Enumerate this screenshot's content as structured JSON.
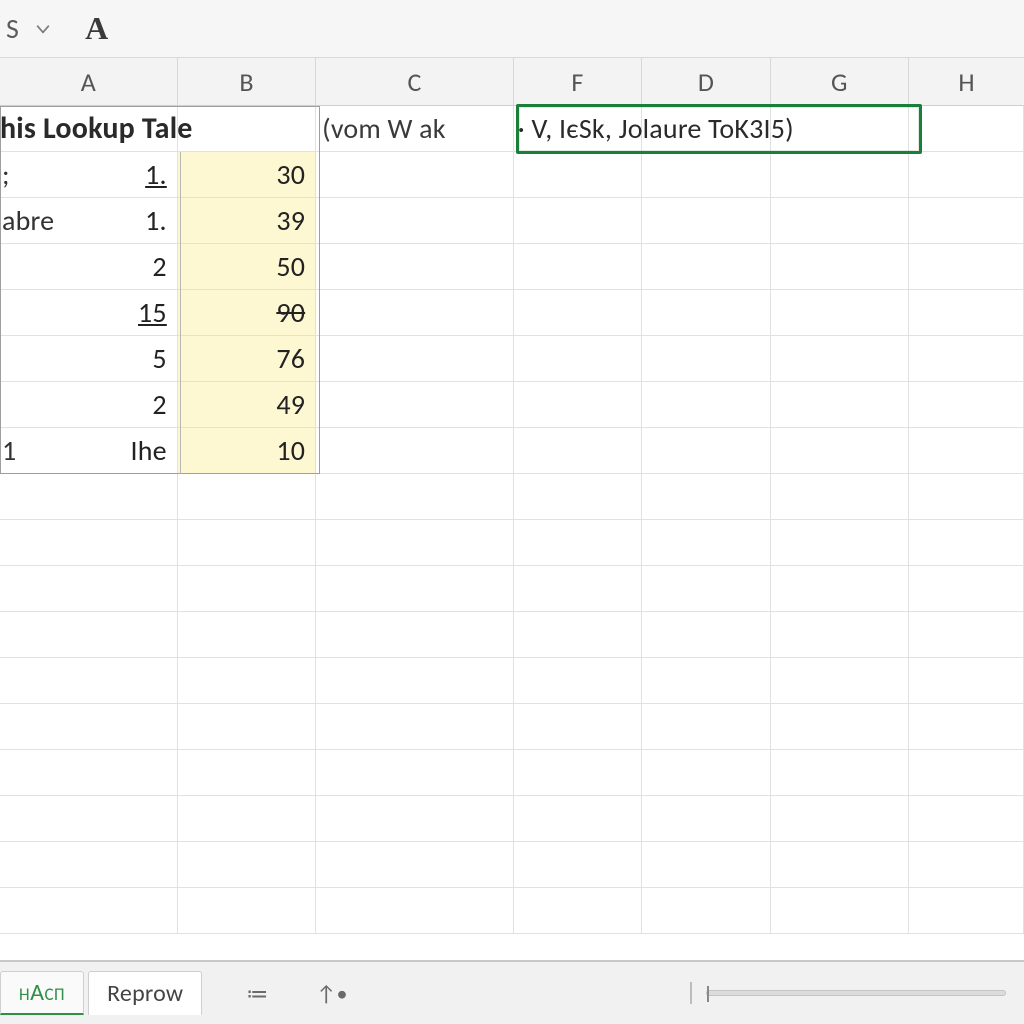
{
  "topbar": {
    "namebox_fragment": "S",
    "font_glyph": "A"
  },
  "columns": [
    "A",
    "B",
    "C",
    "F",
    "D",
    "G",
    "H"
  ],
  "title_row": {
    "heading": "his Lookup Tale",
    "formula_left": "(vom W ak",
    "formula_right": "· V, IєSk, Jolaure ToK3I5)"
  },
  "chart_data": {
    "type": "table",
    "columns": [
      "A",
      "B"
    ],
    "rows": [
      {
        "A": "1.",
        "B": 30,
        "A_prefix": ";",
        "A_underline": true
      },
      {
        "A": "1.",
        "B": 39,
        "A_prefix": "abre"
      },
      {
        "A": "2",
        "B": 50
      },
      {
        "A": "15",
        "B": 90,
        "A_underline": true,
        "B_strike": true
      },
      {
        "A": "5",
        "B": 76
      },
      {
        "A": "2",
        "B": 49
      },
      {
        "A": "Ihe",
        "B": 10,
        "A_prefix": "1"
      }
    ]
  },
  "active_cell": {
    "col_span": [
      "F",
      "D",
      "G"
    ],
    "row": 1
  },
  "statusbar": {
    "tabs": [
      {
        "label": "нАсп",
        "active": true
      },
      {
        "label": "Reprow",
        "active": false
      }
    ],
    "icon1": "≔",
    "icon2": "↑•"
  }
}
